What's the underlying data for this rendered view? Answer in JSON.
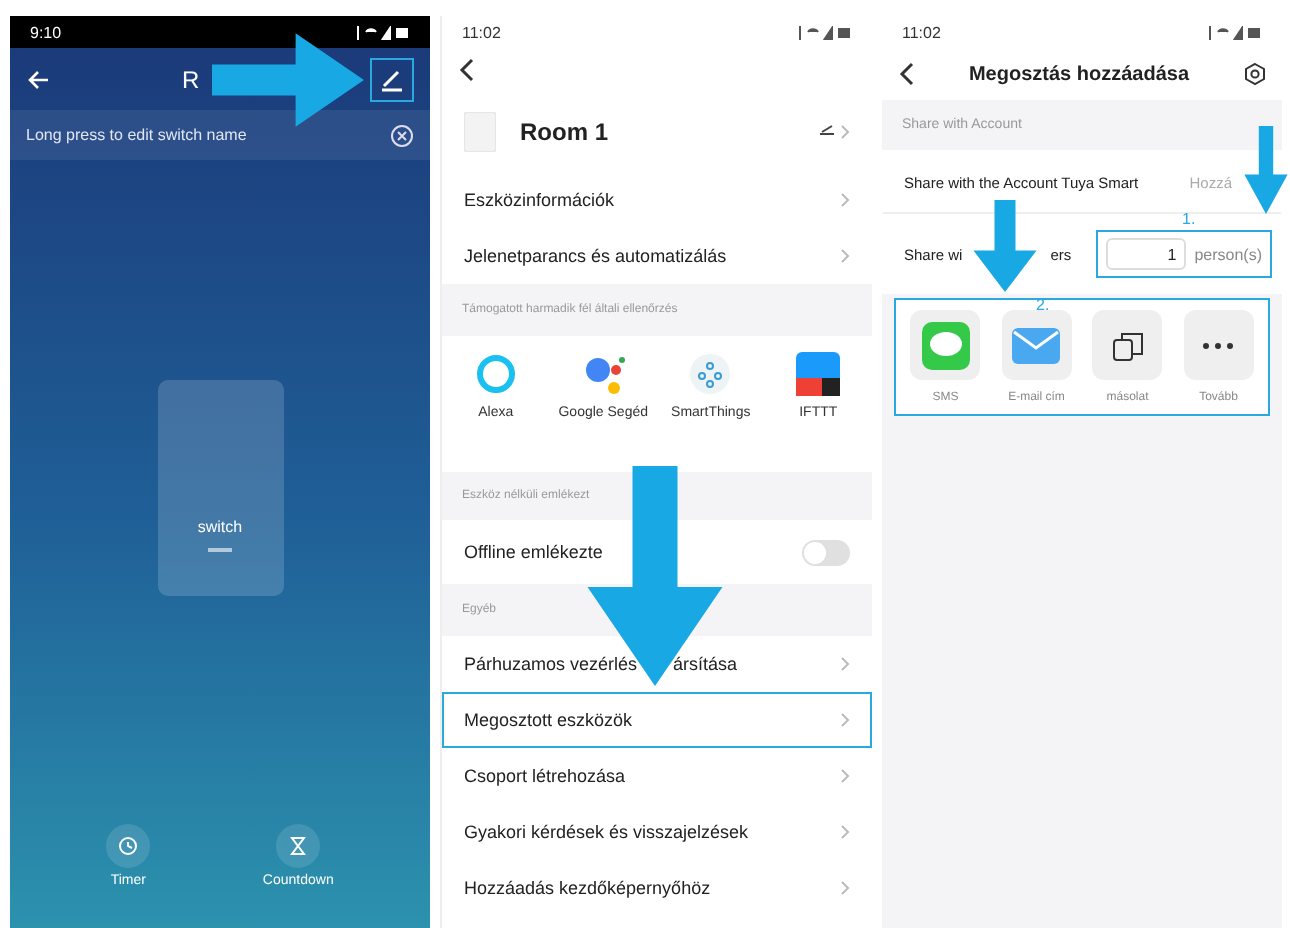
{
  "switch_screen": {
    "status_time": "9:10",
    "title": "R",
    "hint": "Long press to edit switch name",
    "switch_label": "switch",
    "actions": [
      {
        "kind": "timer",
        "label": "Timer"
      },
      {
        "kind": "countdown",
        "label": "Countdown"
      }
    ]
  },
  "device_settings": {
    "status_time": "11:02",
    "device_name": "Room 1",
    "top_items": [
      {
        "label": "Eszközinformációk"
      },
      {
        "label": "Jelenetparancs és automatizálás"
      }
    ],
    "third_party_header": "Támogatott harmadik fél általi ellenőrzés",
    "integrations": [
      {
        "kind": "alexa",
        "label": "Alexa"
      },
      {
        "kind": "google",
        "label": "Google Segéd"
      },
      {
        "kind": "smartthings",
        "label": "SmartThings"
      },
      {
        "kind": "ifttt",
        "label": "IFTTT"
      }
    ],
    "offline_header": "Eszköz nélküli emlékezt",
    "offline": {
      "label": "Offline emlékezte",
      "on": false
    },
    "other_header": "Egyéb",
    "other_items": [
      {
        "label": "Párhuzamos vezérlés",
        "label_tail": "ársítása",
        "highlighted": false
      },
      {
        "label": "Megosztott eszközök",
        "highlighted": true
      },
      {
        "label": "Csoport létrehozása",
        "highlighted": false
      },
      {
        "label": "Gyakori kérdések és visszajelzések",
        "highlighted": false
      },
      {
        "label": "Hozzáadás kezdőképernyőhöz",
        "highlighted": false
      }
    ]
  },
  "add_share": {
    "status_time": "11:02",
    "title": "Megosztás hozzáadása",
    "section": "Share with Account",
    "account_row": {
      "label": "Share with the Account Tuya Smart",
      "action": "Hozzá"
    },
    "step_1": "1.",
    "others_row": {
      "label": "Share wi",
      "label_tail": "ers",
      "count": "1",
      "unit": "person(s)"
    },
    "step_2": "2.",
    "share_options": [
      {
        "kind": "sms",
        "label": "SMS"
      },
      {
        "kind": "email",
        "label": "E-mail cím"
      },
      {
        "kind": "copy",
        "label": "másolat"
      },
      {
        "kind": "more",
        "label": "Tovább"
      }
    ]
  }
}
